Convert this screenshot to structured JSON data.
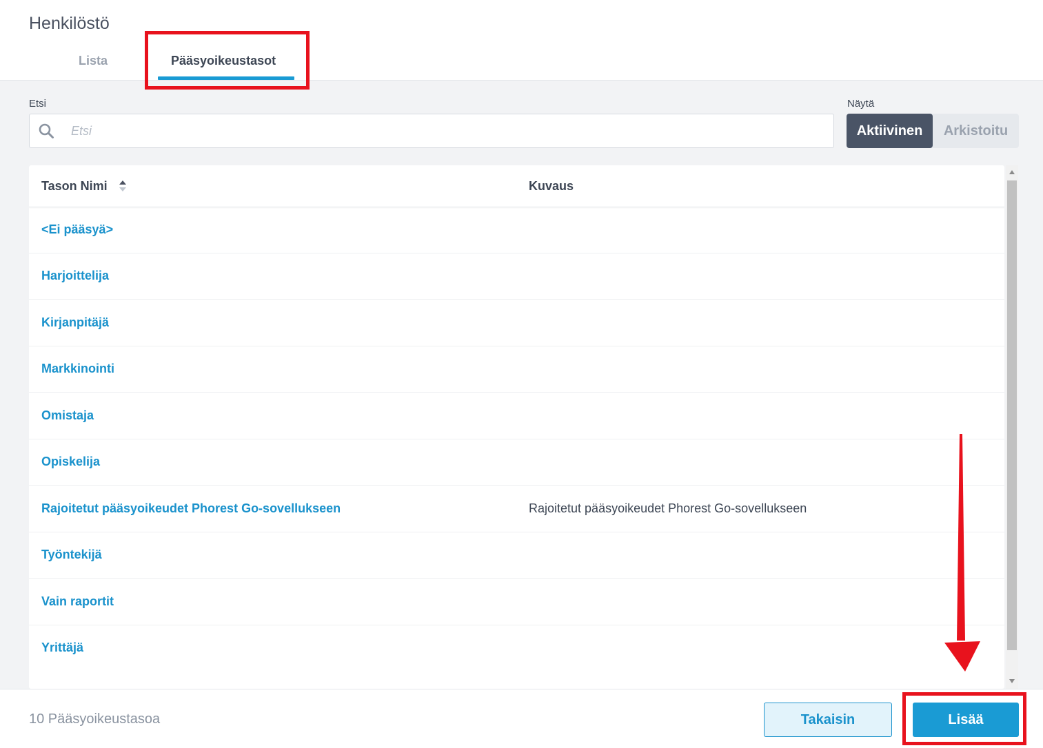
{
  "header": {
    "title": "Henkilöstö",
    "tabs": [
      {
        "label": "Lista",
        "active": false
      },
      {
        "label": "Pääsyoikeustasot",
        "active": true
      }
    ]
  },
  "search": {
    "label": "Etsi",
    "placeholder": "Etsi",
    "value": ""
  },
  "filter": {
    "label": "Näytä",
    "options": [
      "Aktiivinen",
      "Arkistoitu"
    ],
    "selected": "Aktiivinen"
  },
  "table": {
    "columns": [
      "Tason Nimi",
      "Kuvaus"
    ],
    "rows": [
      {
        "name": "<Ei pääsyä>",
        "description": ""
      },
      {
        "name": "Harjoittelija",
        "description": ""
      },
      {
        "name": "Kirjanpitäjä",
        "description": ""
      },
      {
        "name": "Markkinointi",
        "description": ""
      },
      {
        "name": "Omistaja",
        "description": ""
      },
      {
        "name": "Opiskelija",
        "description": ""
      },
      {
        "name": "Rajoitetut pääsyoikeudet Phorest Go-sovellukseen",
        "description": "Rajoitetut pääsyoikeudet Phorest Go-sovellukseen"
      },
      {
        "name": "Työntekijä",
        "description": ""
      },
      {
        "name": "Vain raportit",
        "description": ""
      },
      {
        "name": "Yrittäjä",
        "description": ""
      }
    ]
  },
  "footer": {
    "count_text": "10 Pääsyoikeustasoa",
    "back_label": "Takaisin",
    "add_label": "Lisää"
  },
  "colors": {
    "accent": "#1a9bd4",
    "link": "#1a92cc",
    "highlight": "#e8121d",
    "segment_active": "#4a5466"
  }
}
